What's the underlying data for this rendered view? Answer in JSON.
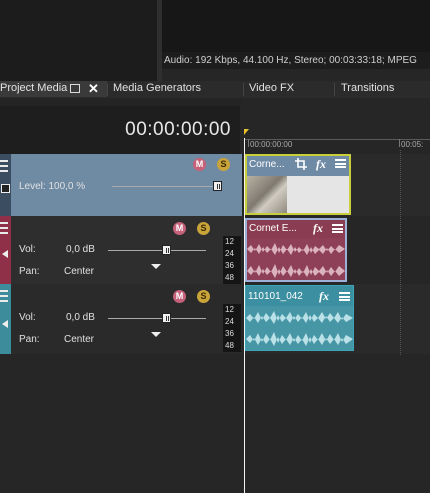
{
  "preview": {
    "audio_info": "Audio: 192 Kbps, 44.100 Hz, Stereo; 00:03:33:18; MPEG"
  },
  "tabs": [
    {
      "label": "Project Media"
    },
    {
      "label": "Media Generators"
    },
    {
      "label": "Video FX"
    },
    {
      "label": "Transitions"
    }
  ],
  "timecode": "00:00:00:00",
  "ruler": {
    "label_start": "00:00:00:00",
    "label_next": "00:05:"
  },
  "video_track": {
    "mute_symbol": "M",
    "solo_symbol": "S",
    "level_label": "Level: 100,0 %",
    "level": 1.0,
    "clip_title": "Corne...",
    "fx_label": "fx",
    "accent_color": "#6a8aa8"
  },
  "audio_track_1": {
    "mute_symbol": "M",
    "solo_symbol": "S",
    "vol_label": "Vol:",
    "vol_value": "0,0 dB",
    "pan_label": "Pan:",
    "pan_value": "Center",
    "meter_labels": [
      "12",
      "24",
      "36",
      "48"
    ],
    "clip_title": "Cornet E...",
    "fx_label": "fx",
    "accent_color": "#9c3a52"
  },
  "audio_track_2": {
    "mute_symbol": "M",
    "solo_symbol": "S",
    "vol_label": "Vol:",
    "vol_value": "0,0 dB",
    "pan_label": "Pan:",
    "pan_value": "Center",
    "meter_labels": [
      "12",
      "24",
      "36",
      "48"
    ],
    "clip_title": "110101_042",
    "fx_label": "fx",
    "accent_color": "#3c8fa0"
  }
}
